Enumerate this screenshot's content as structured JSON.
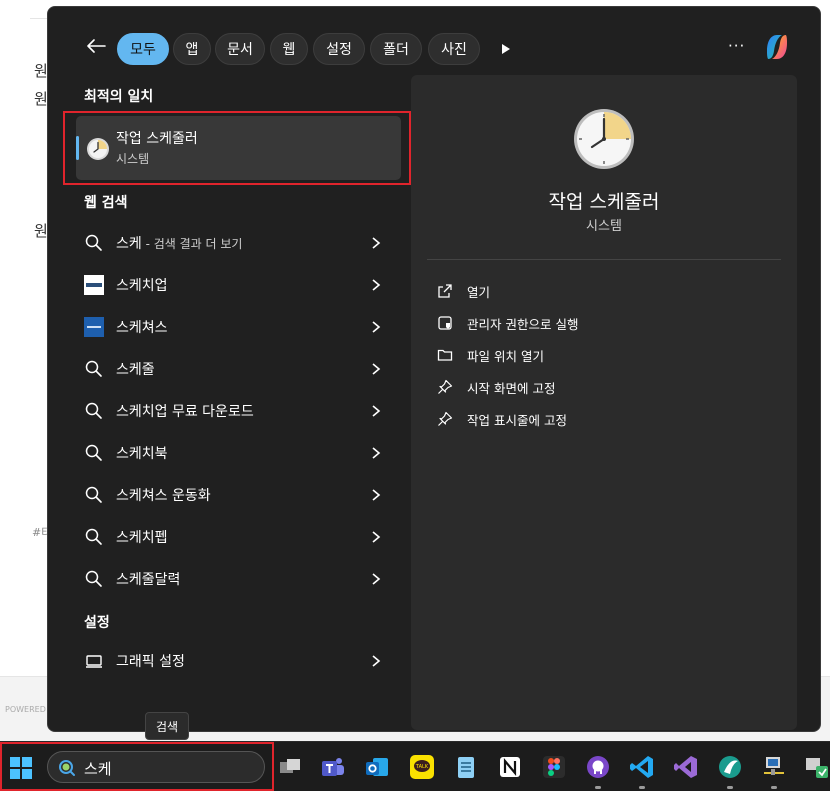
{
  "background": {
    "fragments": [
      "원",
      "원",
      "원",
      "#터",
      "POWERED"
    ]
  },
  "filters": {
    "chips": [
      "모두",
      "앱",
      "문서",
      "웹",
      "설정",
      "폴더",
      "사진"
    ],
    "more": "···"
  },
  "best_match": {
    "heading": "최적의 일치",
    "name": "작업 스케줄러",
    "subtitle": "시스템"
  },
  "web_search": {
    "heading": "웹 검색",
    "items": [
      {
        "label": "스케",
        "suffix": " - 검색 결과 더 보기",
        "icon": "search-icon"
      },
      {
        "label": "스케치업",
        "suffix": "",
        "icon": "sketchup-icon"
      },
      {
        "label": "스케쳐스",
        "suffix": "",
        "icon": "skechers-icon"
      },
      {
        "label": "스케줄",
        "suffix": "",
        "icon": "search-icon"
      },
      {
        "label": "스케치업 무료 다운로드",
        "suffix": "",
        "icon": "search-icon"
      },
      {
        "label": "스케치북",
        "suffix": "",
        "icon": "search-icon"
      },
      {
        "label": "스케쳐스 운동화",
        "suffix": "",
        "icon": "search-icon"
      },
      {
        "label": "스케치펩",
        "suffix": "",
        "icon": "search-icon"
      },
      {
        "label": "스케줄달력",
        "suffix": "",
        "icon": "search-icon"
      }
    ]
  },
  "settings": {
    "heading": "설정",
    "items": [
      {
        "label": "그래픽 설정",
        "icon": "display-icon"
      }
    ]
  },
  "preview": {
    "title": "작업 스케줄러",
    "subtitle": "시스템",
    "actions": [
      {
        "label": "열기",
        "icon": "open-external-icon"
      },
      {
        "label": "관리자 권한으로 실행",
        "icon": "admin-shield-icon"
      },
      {
        "label": "파일 위치 열기",
        "icon": "folder-icon"
      },
      {
        "label": "시작 화면에 고정",
        "icon": "pin-icon"
      },
      {
        "label": "작업 표시줄에 고정",
        "icon": "pin-icon"
      }
    ]
  },
  "tooltip": "검색",
  "taskbar": {
    "search_value": "스케",
    "apps": [
      "task-view-icon",
      "teams-icon",
      "outlook-icon",
      "kakaotalk-icon",
      "notepad-icon",
      "notion-icon",
      "figma-icon",
      "github-icon",
      "vscode-icon",
      "visual-studio-icon",
      "app-icon",
      "network-icon",
      "security-icon"
    ]
  },
  "colors": {
    "accent": "#63b7f0",
    "panel": "#202020",
    "highlight_box": "#e0242c"
  }
}
